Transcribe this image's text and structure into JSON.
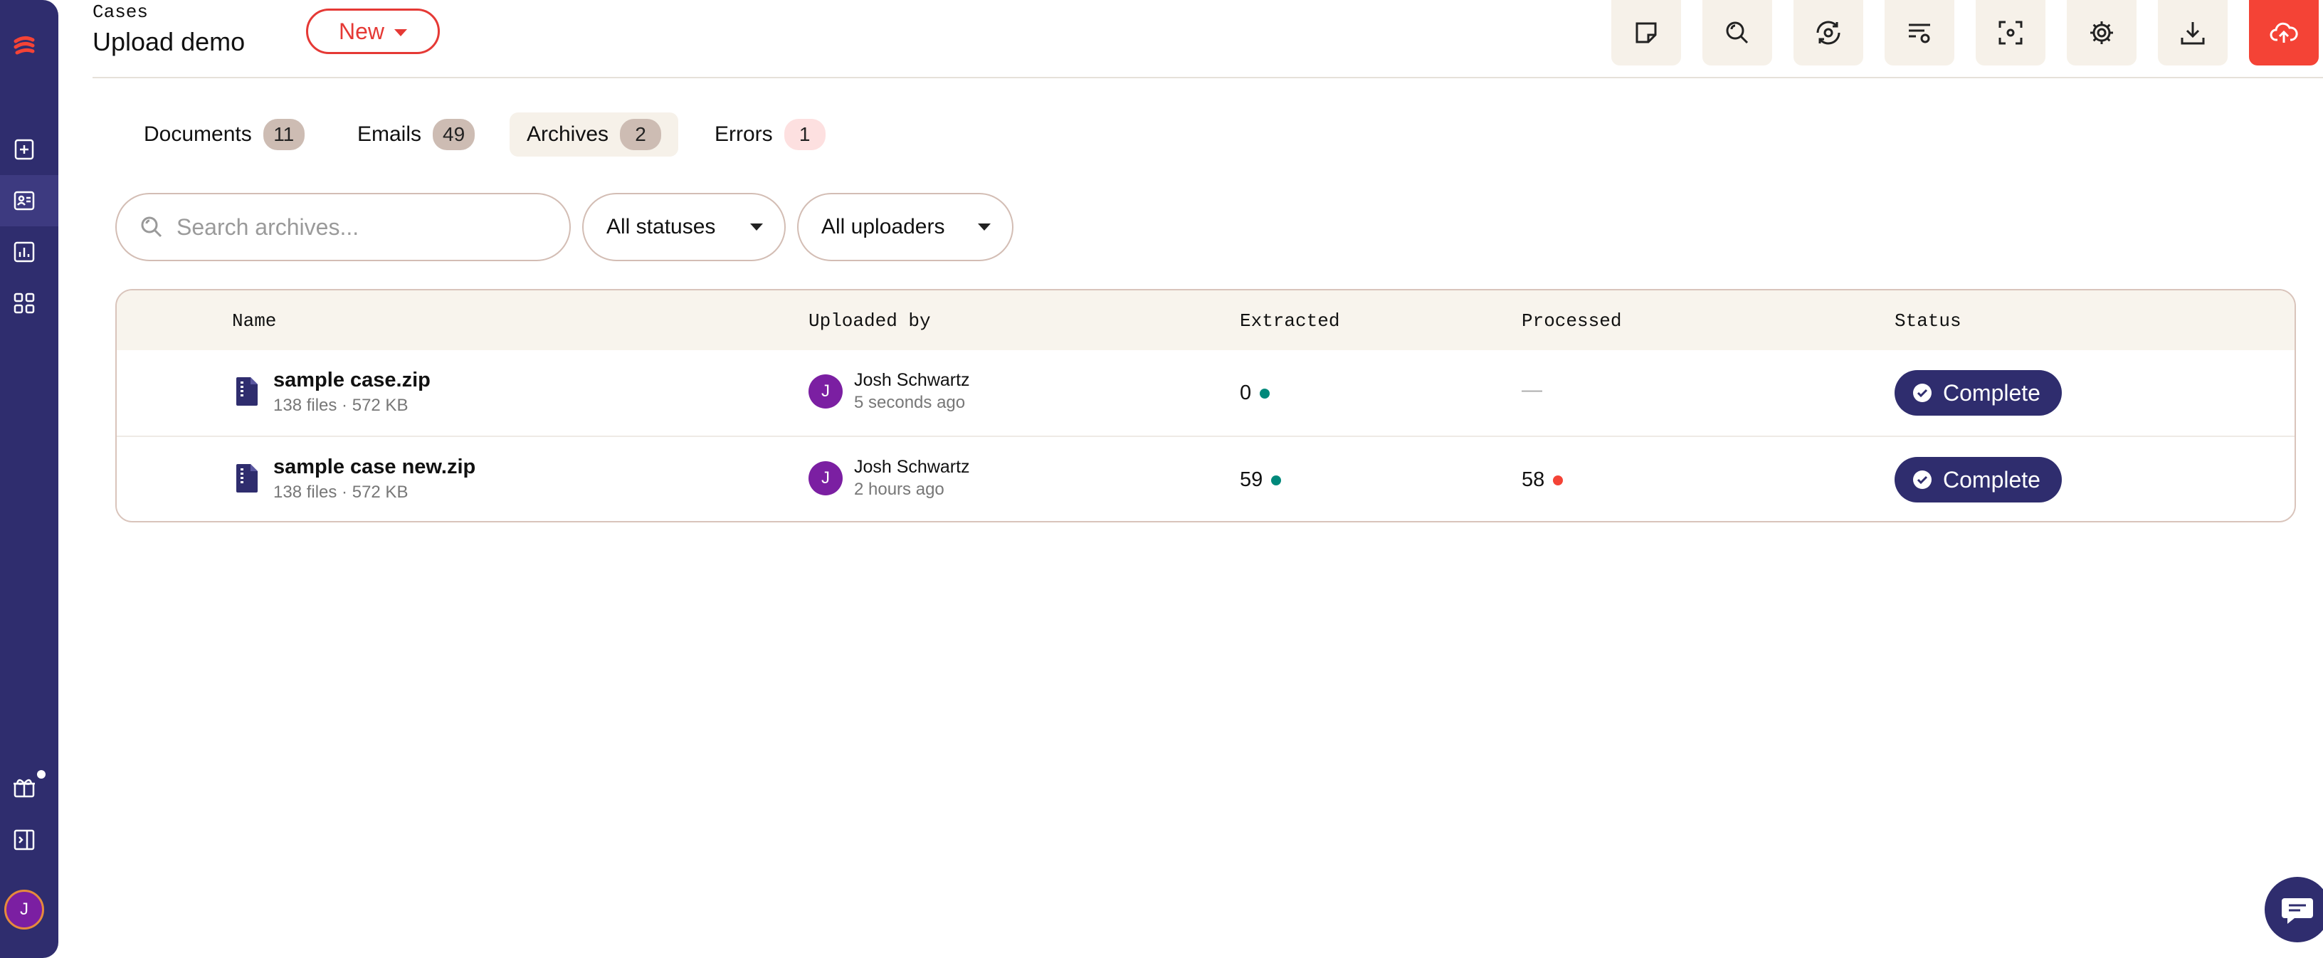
{
  "header": {
    "breadcrumb": "Cases",
    "title": "Upload demo",
    "new_button": "New"
  },
  "toolbar": {
    "icons": [
      "note-icon",
      "search-zoom-icon",
      "eye-refresh-icon",
      "filter-settings-icon",
      "focus-scan-icon",
      "gear-icon",
      "download-icon",
      "cloud-upload-icon"
    ]
  },
  "tabs": [
    {
      "label": "Documents",
      "count": "11"
    },
    {
      "label": "Emails",
      "count": "49"
    },
    {
      "label": "Archives",
      "count": "2"
    },
    {
      "label": "Errors",
      "count": "1"
    }
  ],
  "filters": {
    "search_placeholder": "Search archives...",
    "status_select": "All statuses",
    "uploader_select": "All uploaders"
  },
  "table": {
    "columns": [
      "Name",
      "Uploaded by",
      "Extracted",
      "Processed",
      "Status"
    ],
    "rows": [
      {
        "name": "sample case.zip",
        "meta": "138 files · 572 KB",
        "uploader_initial": "J",
        "uploader": "Josh Schwartz",
        "uploaded_time": "5 seconds ago",
        "extracted": "0",
        "processed": "—",
        "status": "Complete"
      },
      {
        "name": "sample case new.zip",
        "meta": "138 files · 572 KB",
        "uploader_initial": "J",
        "uploader": "Josh Schwartz",
        "uploaded_time": "2 hours ago",
        "extracted": "59",
        "processed": "58",
        "status": "Complete"
      }
    ]
  },
  "sidebar": {
    "user_initial": "J"
  },
  "colors": {
    "sidebar": "#2f2d6e",
    "accent_red": "#e53935",
    "teal_dot": "#00897b",
    "red_dot": "#f44336",
    "avatar_purple": "#7b1fa2"
  }
}
